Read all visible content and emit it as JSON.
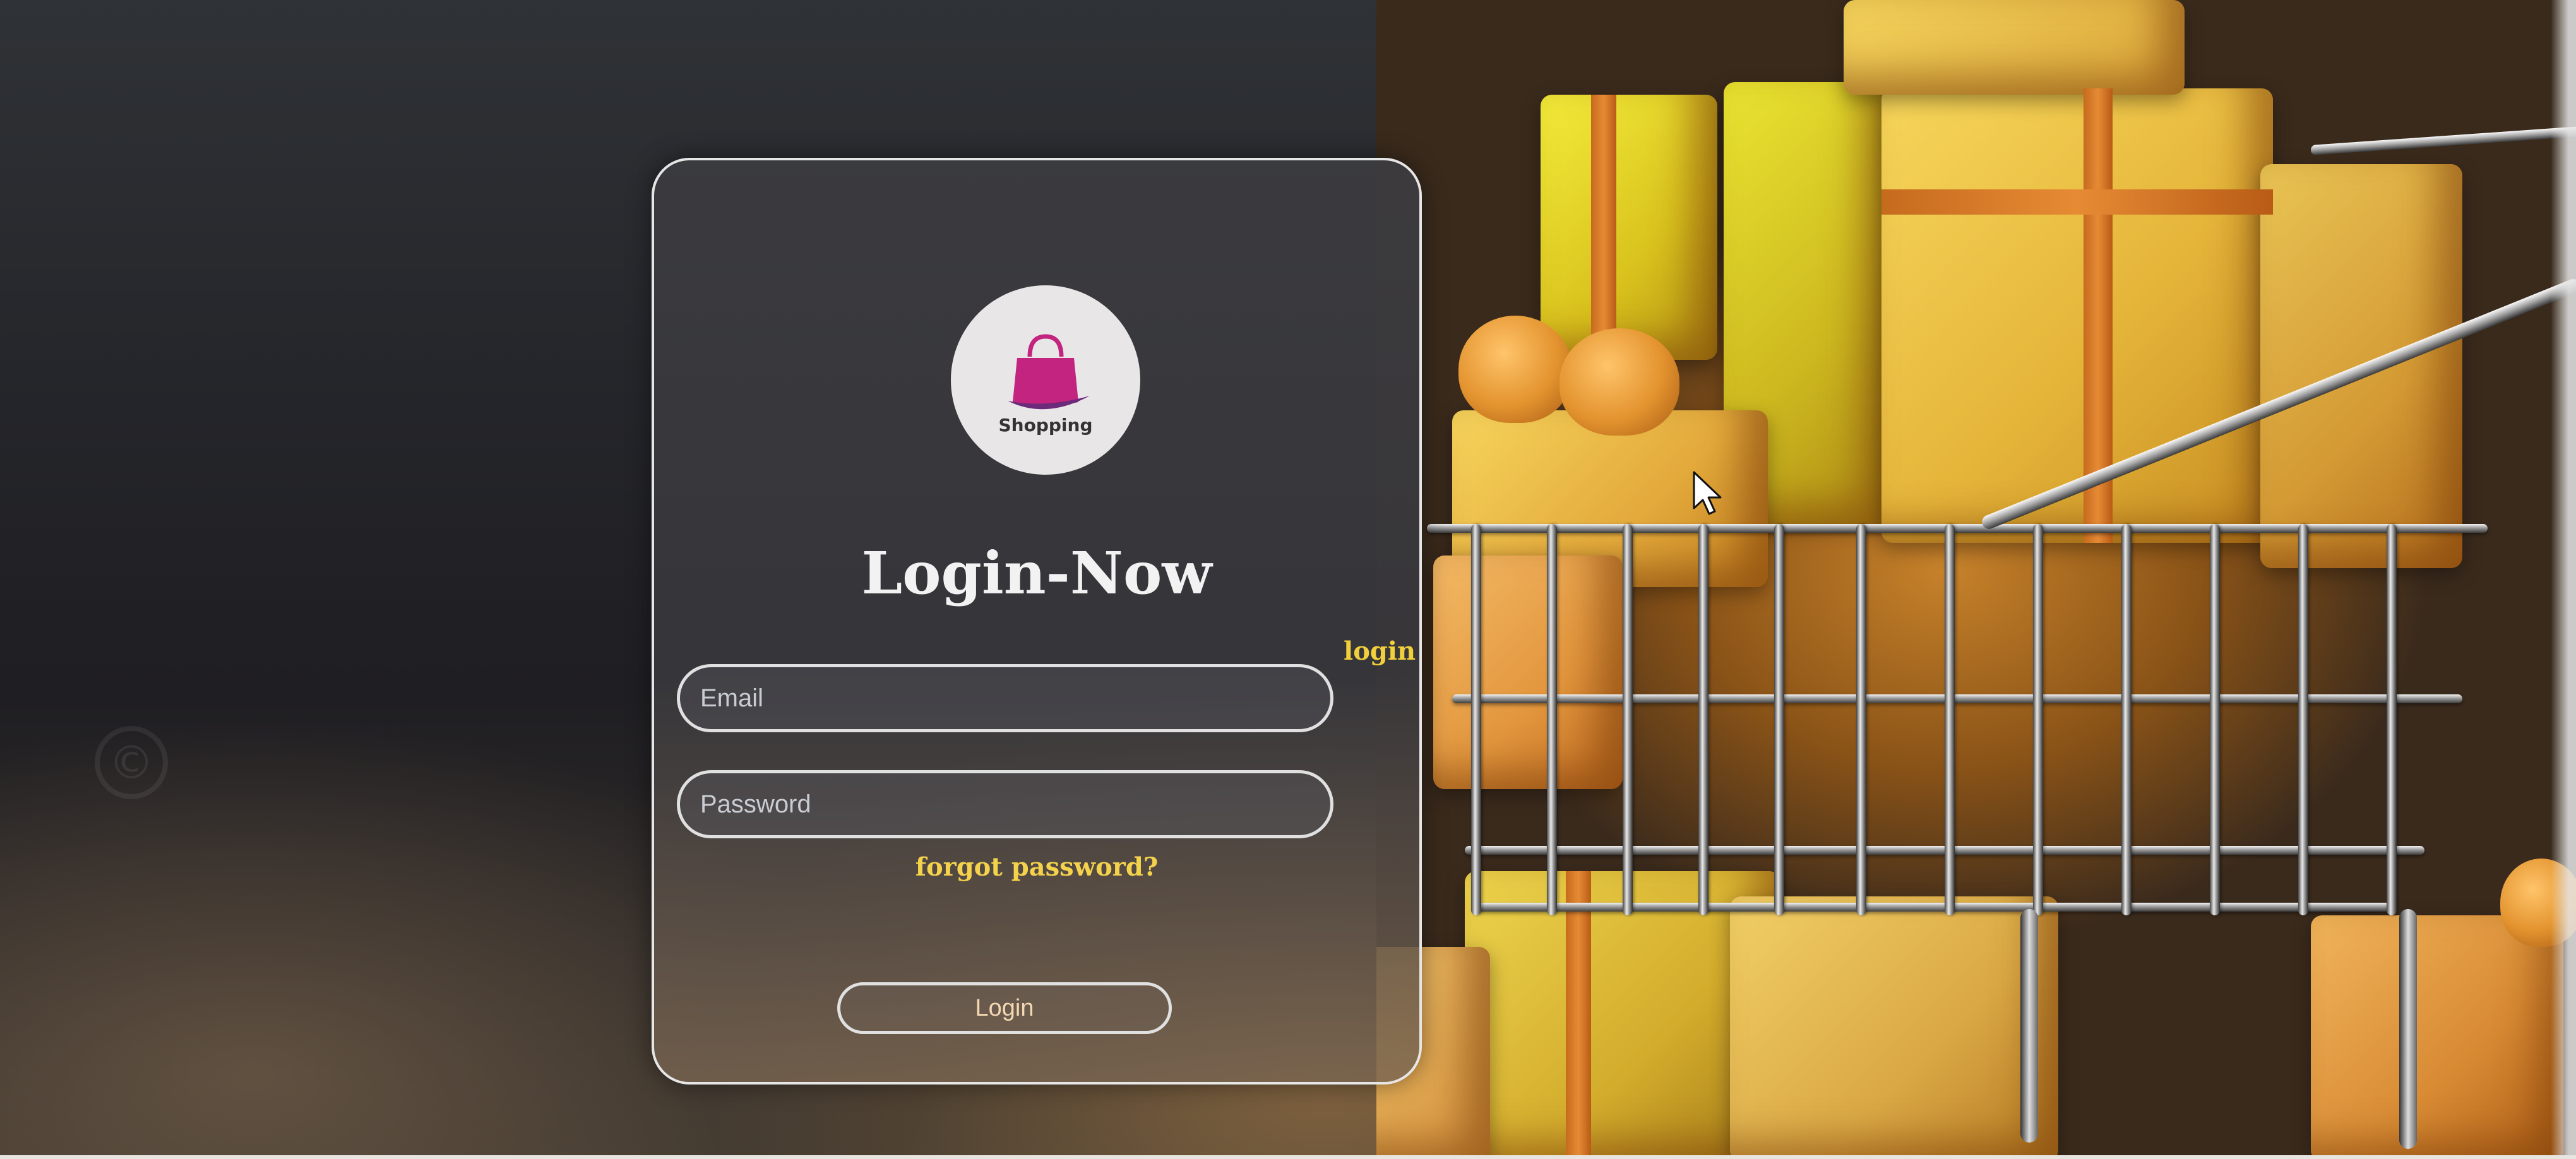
{
  "login_card": {
    "logo_text": "Shopping",
    "title": "Login-Now",
    "email_placeholder": "Email",
    "password_placeholder": "Password",
    "forgot_password_label": "forgot password?",
    "login_button_label": "Login"
  },
  "side_link": {
    "label": "login"
  },
  "background": {
    "watermark_symbol": "©"
  },
  "colors": {
    "accent_yellow": "#f4d24c",
    "card_border": "#e6e6e6",
    "logo_bag": "#c2247f"
  }
}
